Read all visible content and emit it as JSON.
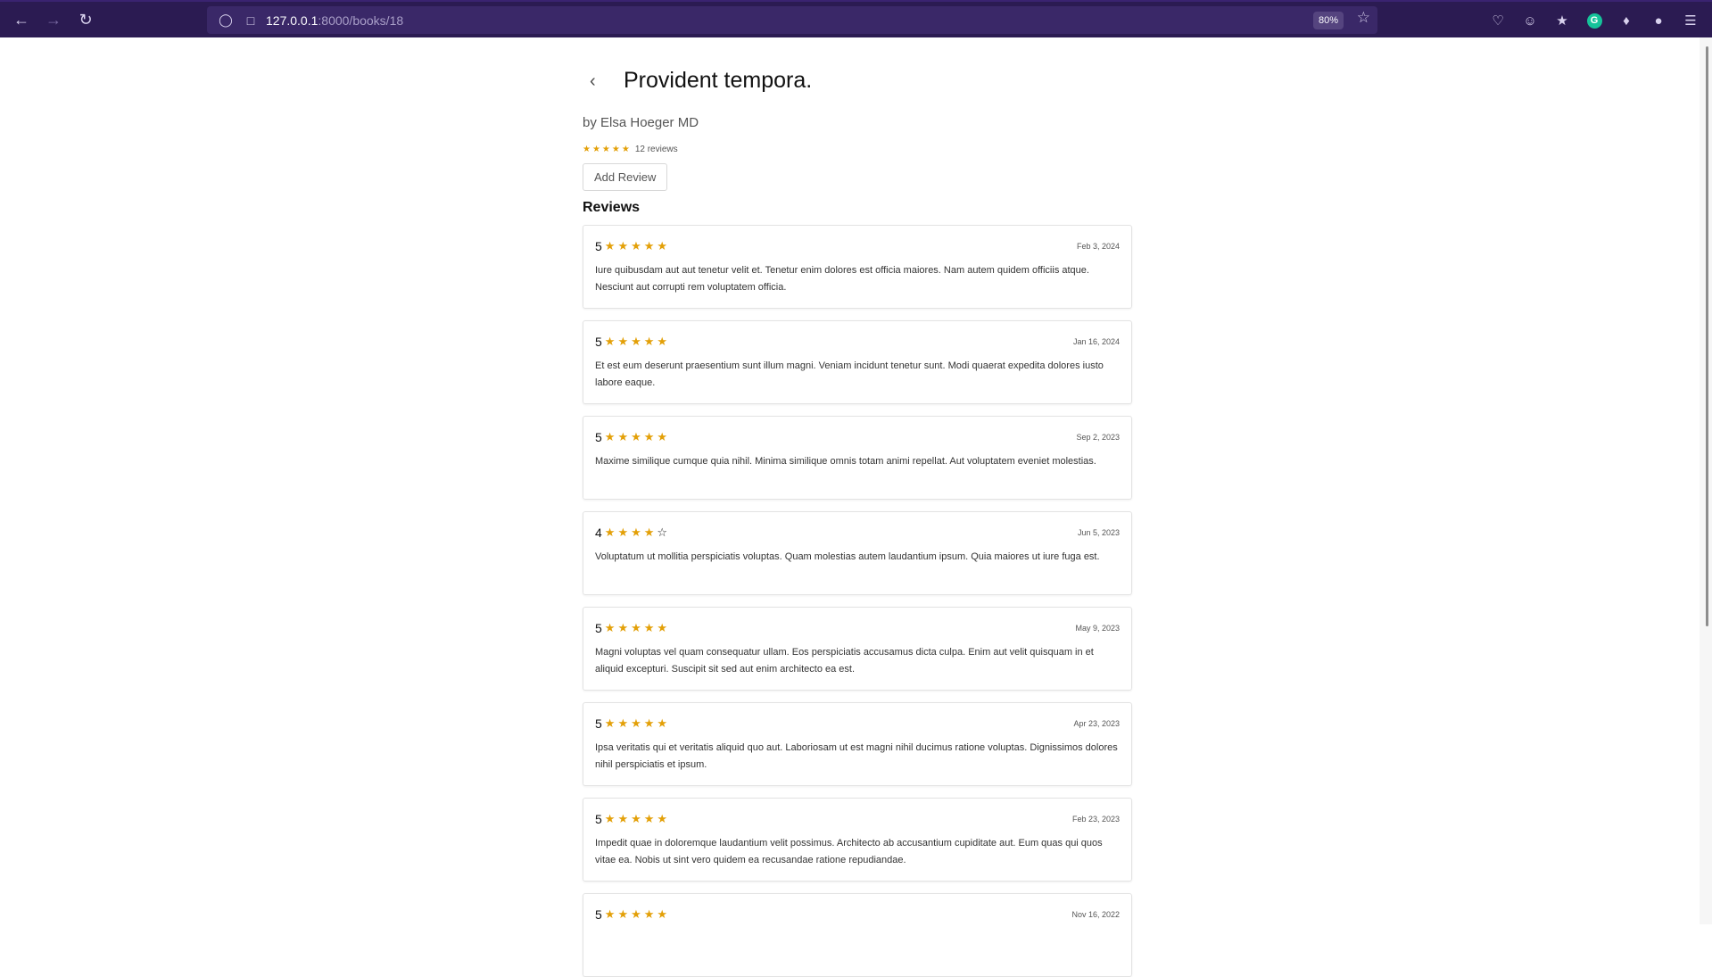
{
  "browser": {
    "url_host": "127.0.0.1",
    "url_path": ":8000/books/18",
    "zoom": "80%"
  },
  "book": {
    "title": "Provident tempora.",
    "author": "by Elsa Hoeger MD",
    "rating_stars": "★★★★★",
    "review_count": "12 reviews",
    "add_review_label": "Add Review",
    "reviews_heading": "Reviews"
  },
  "reviews": [
    {
      "score": "5",
      "stars": "★★★★★",
      "empty": "",
      "date": "Feb 3, 2024",
      "text": "Iure quibusdam aut aut tenetur velit et. Tenetur enim dolores est officia maiores. Nam autem quidem officiis atque. Nesciunt aut corrupti rem voluptatem officia."
    },
    {
      "score": "5",
      "stars": "★★★★★",
      "empty": "",
      "date": "Jan 16, 2024",
      "text": "Et est eum deserunt praesentium sunt illum magni. Veniam incidunt tenetur sunt. Modi quaerat expedita dolores iusto labore eaque."
    },
    {
      "score": "5",
      "stars": "★★★★★",
      "empty": "",
      "date": "Sep 2, 2023",
      "text": "Maxime similique cumque quia nihil. Minima similique omnis totam animi repellat. Aut voluptatem eveniet molestias."
    },
    {
      "score": "4",
      "stars": "★★★★",
      "empty": "☆",
      "date": "Jun 5, 2023",
      "text": "Voluptatum ut mollitia perspiciatis voluptas. Quam molestias autem laudantium ipsum. Quia maiores ut iure fuga est."
    },
    {
      "score": "5",
      "stars": "★★★★★",
      "empty": "",
      "date": "May 9, 2023",
      "text": "Magni voluptas vel quam consequatur ullam. Eos perspiciatis accusamus dicta culpa. Enim aut velit quisquam in et aliquid excepturi. Suscipit sit sed aut enim architecto ea est."
    },
    {
      "score": "5",
      "stars": "★★★★★",
      "empty": "",
      "date": "Apr 23, 2023",
      "text": "Ipsa veritatis qui et veritatis aliquid quo aut. Laboriosam ut est magni nihil ducimus ratione voluptas. Dignissimos dolores nihil perspiciatis et ipsum."
    },
    {
      "score": "5",
      "stars": "★★★★★",
      "empty": "",
      "date": "Feb 23, 2023",
      "text": "Impedit quae in doloremque laudantium velit possimus. Architecto ab accusantium cupiditate aut. Eum quas qui quos vitae ea. Nobis ut sint vero quidem ea recusandae ratione repudiandae."
    },
    {
      "score": "5",
      "stars": "★★★★★",
      "empty": "",
      "date": "Nov 16, 2022",
      "text": ""
    }
  ],
  "colors": {
    "toolbar_bg": "#2b1b52",
    "star": "#e3a008"
  }
}
